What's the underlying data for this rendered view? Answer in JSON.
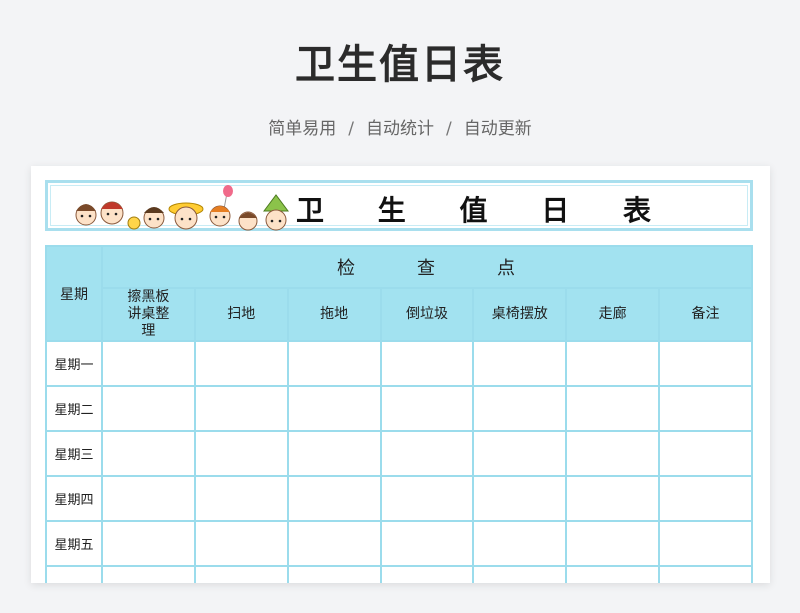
{
  "header": {
    "title": "卫生值日表",
    "subtitle": [
      "简单易用",
      "自动统计",
      "自动更新"
    ],
    "separator": "/"
  },
  "sheet": {
    "banner_title": "卫 生 值 日 表",
    "table": {
      "day_header": "星期",
      "group_header": [
        "检",
        "查",
        "点"
      ],
      "columns": [
        "擦黑板讲桌整理",
        "扫地",
        "拖地",
        "倒垃圾",
        "桌椅摆放",
        "走廊",
        "备注"
      ],
      "rows": [
        "星期一",
        "星期二",
        "星期三",
        "星期四",
        "星期五"
      ]
    }
  }
}
